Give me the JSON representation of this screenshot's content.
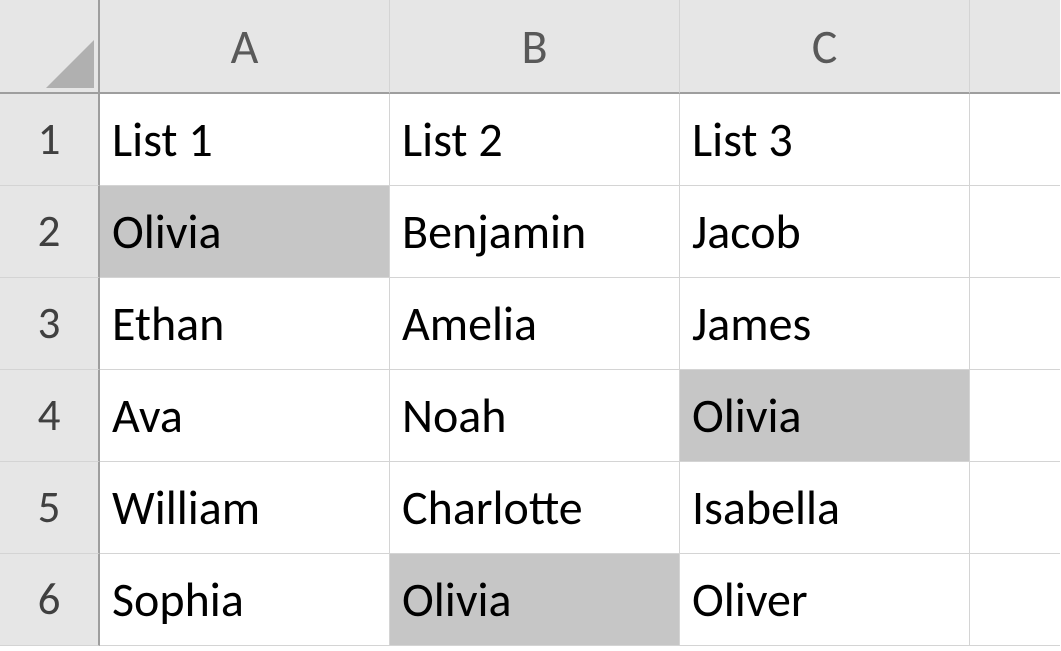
{
  "colors": {
    "headerBg": "#e6e6e6",
    "highlight": "#c6c6c6",
    "gridLine": "#d4d4d4",
    "accent": "#217346"
  },
  "columns": [
    "A",
    "B",
    "C"
  ],
  "rows": [
    "1",
    "2",
    "3",
    "4",
    "5",
    "6"
  ],
  "cells": {
    "A1": "List 1",
    "B1": "List 2",
    "C1": "List 3",
    "A2": "Olivia",
    "B2": "Benjamin",
    "C2": "Jacob",
    "A3": "Ethan",
    "B3": "Amelia",
    "C3": "James",
    "A4": "Ava",
    "B4": "Noah",
    "C4": "Olivia",
    "A5": "William",
    "B5": "Charlotte",
    "C5": "Isabella",
    "A6": "Sophia",
    "B6": "Olivia",
    "C6": "Oliver"
  },
  "highlighted": [
    "A2",
    "B6",
    "C4"
  ],
  "chart_data": {
    "type": "table",
    "title": "",
    "columns": [
      "List 1",
      "List 2",
      "List 3"
    ],
    "rows": [
      [
        "Olivia",
        "Benjamin",
        "Jacob"
      ],
      [
        "Ethan",
        "Amelia",
        "James"
      ],
      [
        "Ava",
        "Noah",
        "Olivia"
      ],
      [
        "William",
        "Charlotte",
        "Isabella"
      ],
      [
        "Sophia",
        "Olivia",
        "Oliver"
      ]
    ]
  }
}
